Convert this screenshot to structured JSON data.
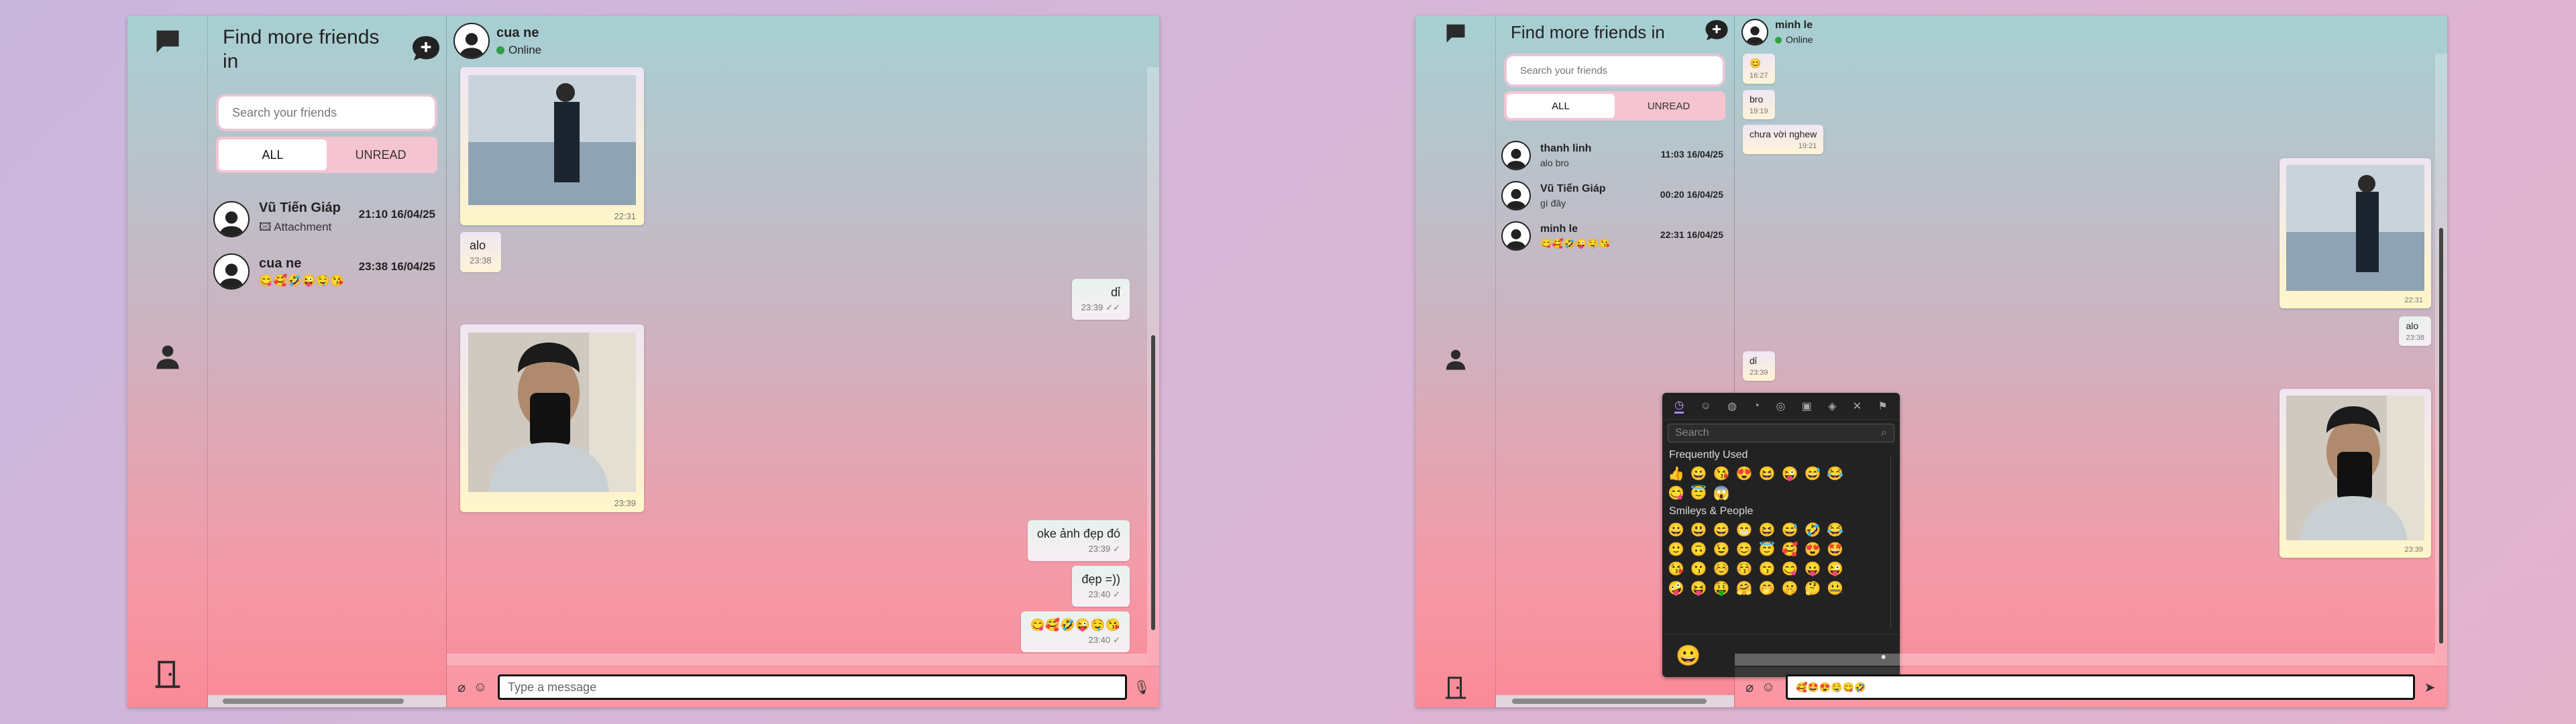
{
  "left_window": {
    "title": "Find more friends in",
    "search_placeholder": "Search your friends",
    "tabs": [
      "ALL",
      "UNREAD"
    ],
    "conversations": [
      {
        "name": "Vũ Tiến Giáp",
        "preview": "Attachment",
        "time": "21:10 16/04/25"
      },
      {
        "name": "cua ne",
        "preview": "😋🥰🤣😜🤤😘",
        "time": "23:38 16/04/25"
      }
    ],
    "chat": {
      "contact": "cua ne",
      "status": "Online",
      "messages": [
        {
          "text": "",
          "time": "22:31"
        },
        {
          "text": "alo",
          "time": "23:38"
        },
        {
          "text": "dỉ",
          "time": "23:39"
        },
        {
          "text": "",
          "time": "23:39"
        },
        {
          "text": "oke ảnh đẹp đó",
          "time": "23:39"
        },
        {
          "text": "đẹp =))",
          "time": "23:40"
        },
        {
          "text": "😋🥰🤣😜🤤😘",
          "time": "23:40"
        }
      ],
      "composer_placeholder": "Type a message"
    }
  },
  "right_window": {
    "title": "Find more friends in",
    "search_placeholder": "Search your friends",
    "tabs": [
      "ALL",
      "UNREAD"
    ],
    "conversations": [
      {
        "name": "thanh linh",
        "preview": "alo bro",
        "time": "11:03 16/04/25"
      },
      {
        "name": "Vũ Tiến Giáp",
        "preview": "gì đây",
        "time": "00:20 16/04/25"
      },
      {
        "name": "minh le",
        "preview": "😋🥰🤣😜🤤😘",
        "time": "22:31 16/04/25"
      }
    ],
    "chat": {
      "contact": "minh le",
      "status": "Online",
      "messages": [
        {
          "text": "😊",
          "time": "16:27"
        },
        {
          "text": "bro",
          "time": "19:19"
        },
        {
          "text": "chưa vời nghew",
          "time": "19:21"
        },
        {
          "text": "",
          "time": "22:31"
        },
        {
          "text": "alo",
          "time": "23:38"
        },
        {
          "text": "dỉ",
          "time": "23:39"
        },
        {
          "text": "",
          "time": "23:39"
        }
      ],
      "composer_value": "🥰🤩😍🤤😋🤣"
    },
    "emoji_picker": {
      "search_placeholder": "Search",
      "section_frequent": "Frequently Used",
      "frequent_row1": [
        "👍",
        "😀",
        "😘",
        "😍",
        "😆",
        "😜",
        "😅",
        "😂"
      ],
      "frequent_row2": [
        "😋",
        "😇",
        "😱"
      ],
      "section_smileys": "Smileys & People",
      "smileys_rows": [
        [
          "😀",
          "😃",
          "😄",
          "😁",
          "😆",
          "😅",
          "🤣",
          "😂"
        ],
        [
          "🙂",
          "🙃",
          "😉",
          "😊",
          "😇",
          "🥰",
          "😍",
          "🤩"
        ],
        [
          "😘",
          "😗",
          "☺️",
          "😚",
          "😙",
          "😋",
          "😛",
          "😜"
        ],
        [
          "🤪",
          "😝",
          "🤑",
          "🤗",
          "🤭",
          "🤫",
          "🤔",
          "🤐"
        ]
      ],
      "preview_emoji": "😀"
    }
  }
}
